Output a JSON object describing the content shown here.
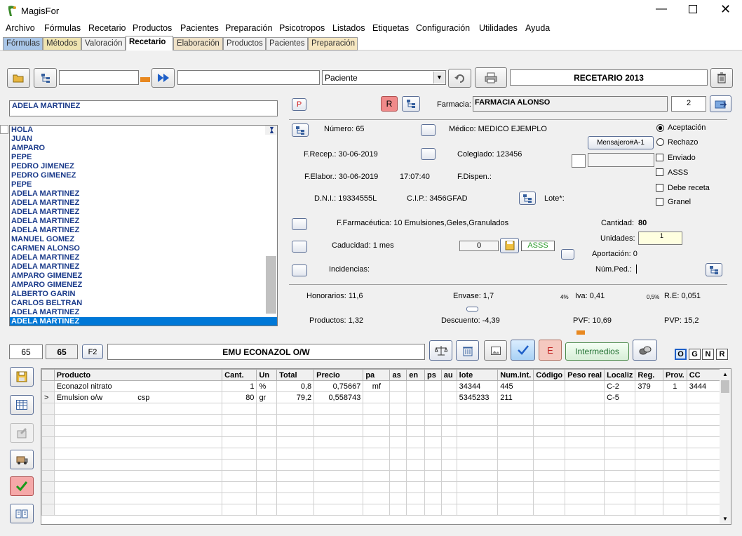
{
  "window": {
    "title": "MagisFor"
  },
  "menu": [
    "Archivo",
    "Fórmulas",
    "Recetario",
    "Productos",
    "Pacientes",
    "Preparación",
    "Psicotropos",
    "Listados",
    "Etiquetas",
    "Configuración",
    "Utilidades",
    "Ayuda"
  ],
  "tabs": [
    {
      "label": "Fórmulas",
      "color": "#a9c6e8"
    },
    {
      "label": "Métodos",
      "color": "#efe4b0"
    },
    {
      "label": "Valoración",
      "color": "#f0f0f0"
    },
    {
      "label": "Recetario",
      "color": "#ffffff"
    },
    {
      "label": "Elaboración",
      "color": "#f0e2c8"
    },
    {
      "label": "Productos",
      "color": "#f0f0f0"
    },
    {
      "label": "Pacientes",
      "color": "#f0f0f0"
    },
    {
      "label": "Preparación",
      "color": "#f5e6c0"
    }
  ],
  "toolbar": {
    "paciente_select": "Paciente",
    "recetario_title": "RECETARIO 2013"
  },
  "patient": {
    "name": "ADELA MARTINEZ"
  },
  "patient_list": [
    "HOLA",
    "JUAN",
    "AMPARO",
    "PEPE",
    "PEDRO JIMENEZ",
    "PEDRO GIMENEZ",
    "PEPE",
    "ADELA MARTINEZ",
    "ADELA MARTINEZ",
    "ADELA MARTINEZ",
    "ADELA MARTINEZ",
    "ADELA MARTINEZ",
    "MANUEL GOMEZ",
    "CARMEN ALONSO",
    "ADELA MARTINEZ",
    "ADELA MARTINEZ",
    "AMPARO GIMENEZ",
    "AMPARO GIMENEZ",
    "ALBERTO GARIN",
    "CARLOS BELTRAN",
    "ADELA MARTINEZ",
    "ADELA MARTINEZ"
  ],
  "flags": {
    "p": "P",
    "r": "R"
  },
  "farmacia": {
    "label": "Farmacia:",
    "value": "FARMACIA ALONSO",
    "count": "2"
  },
  "receta": {
    "numero": "Número: 65",
    "medico": "Médico: MEDICO EJEMPLO",
    "mensajero": "Mensajero#A-1",
    "frecep": "F.Recep.:  30-06-2019",
    "colegiado": "Colegiado: 123456",
    "felabor": "F.Elabor.:  30-06-2019",
    "hora": "17:07:40",
    "fdispen": "F.Dispen.:",
    "dni": "D.N.I.: 19334555L",
    "cip": "C.I.P.: 3456GFAD",
    "lote": "Lote*:",
    "ffarm": "F.Farmacéutica: 10 Emulsiones,Geles,Granulados",
    "caducidad": "Caducidad: 1 mes",
    "incidencias": "Incidencias:",
    "cad_value": "0",
    "asss_badge": "ASSS"
  },
  "options": {
    "aceptacion": "Aceptación",
    "rechazo": "Rechazo",
    "enviado": "Enviado",
    "asss": "ASSS",
    "debe_receta": "Debe receta",
    "granel": "Granel"
  },
  "cantidades": {
    "cantidad_label": "Cantidad:",
    "cantidad": "80",
    "unidades_label": "Unidades:",
    "unidades": "1",
    "aportacion": "Aportación:   0",
    "numped": "Núm.Ped.:"
  },
  "totals": {
    "honorarios": "Honorarios: 11,6",
    "envase": "Envase:  1,7",
    "iva_pct": "4%",
    "iva": "Iva: 0,41",
    "re_pct": "0,5%",
    "re": "R.E: 0,051",
    "productos": "Productos: 1,32",
    "descuento": "Descuento:  -4,39",
    "pvf": "PVF: 10,69",
    "pvp": "PVP: 15,2"
  },
  "formula": {
    "num": "65",
    "num_bold": "65",
    "f2": "F2",
    "name": "EMU ECONAZOL O/W",
    "e": "E",
    "intermedios": "Intermedios",
    "ognr": [
      "O",
      "G",
      "N",
      "R"
    ]
  },
  "grid": {
    "columns": [
      "Producto",
      "Cant.",
      "Un",
      "Total",
      "Precio",
      "pa",
      "as",
      "en",
      "ps",
      "au",
      "lote",
      "Num.Int.",
      "Código",
      "Peso real",
      "Localiz",
      "Reg.",
      "Prov.",
      "CC"
    ],
    "rows": [
      {
        "marker": "",
        "producto": "Econazol nitrato",
        "extra": "",
        "cant": "1",
        "un": "%",
        "total": "0,8",
        "precio": "0,75667",
        "pa": "mf",
        "lote": "34344",
        "numint": "445",
        "localiz": "C-2",
        "reg": "379",
        "prov": "1",
        "cc": "3444"
      },
      {
        "marker": ">",
        "producto": "Emulsion o/w",
        "extra": "csp",
        "cant": "80",
        "un": "gr",
        "total": "79,2",
        "precio": "0,558743",
        "pa": "",
        "lote": "5345233",
        "numint": "211",
        "localiz": "C-5",
        "reg": "",
        "prov": "",
        "cc": ""
      }
    ]
  }
}
